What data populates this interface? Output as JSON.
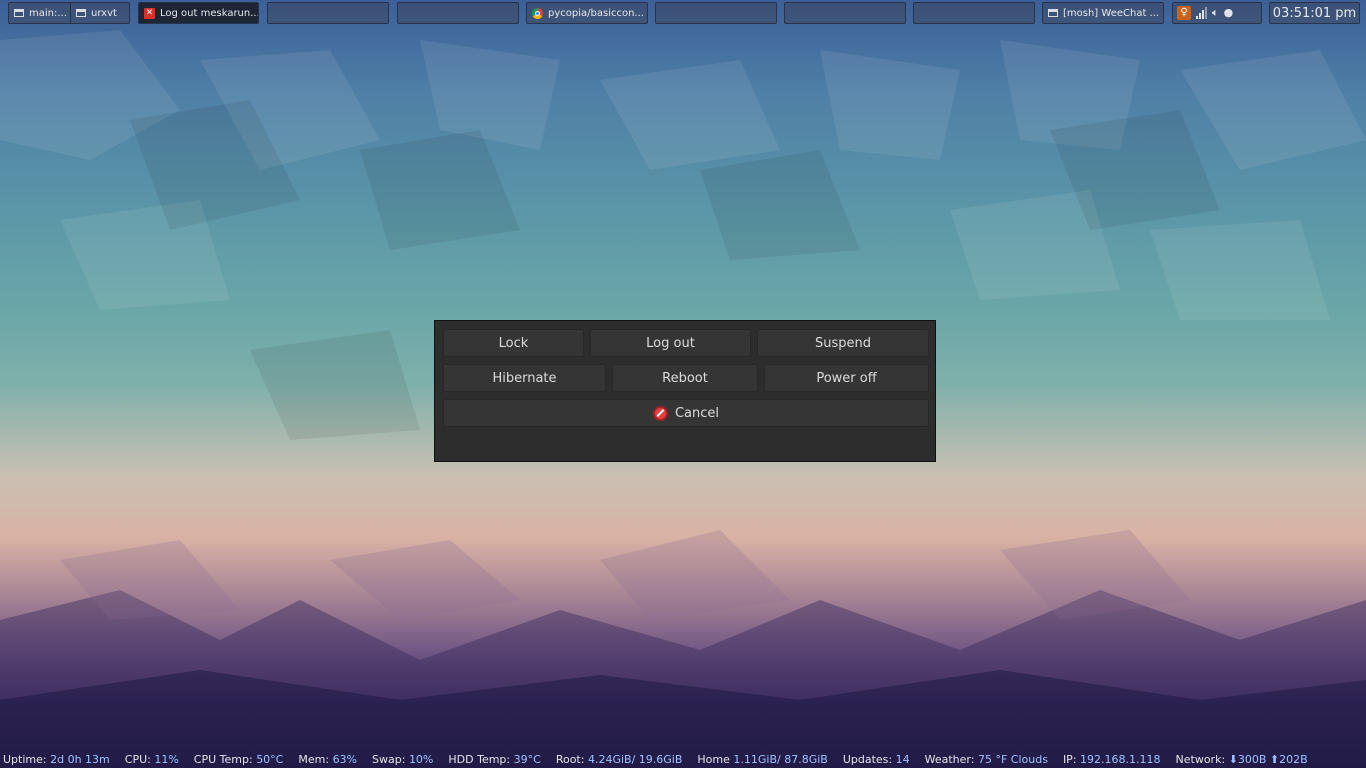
{
  "taskbar": {
    "tasks": [
      {
        "label": "main:...",
        "icon": "window-icon"
      },
      {
        "label": "urxvt",
        "icon": "window-icon"
      },
      {
        "label": "Log out meskarun...",
        "icon": "close-x-icon"
      },
      {
        "label": "pycopia/basiccon...",
        "icon": "chrome-icon"
      },
      {
        "label": "[mosh] WeeChat ...",
        "icon": "window-icon"
      }
    ],
    "tray_icons": [
      "ubuntu-one-icon",
      "network-signal-icon",
      "volume-icon",
      "user-icon"
    ],
    "clock": "03:51:01 pm"
  },
  "logout_dialog": {
    "buttons": {
      "lock": "Lock",
      "logout": "Log out",
      "suspend": "Suspend",
      "hibernate": "Hibernate",
      "reboot": "Reboot",
      "poweroff": "Power off",
      "cancel": "Cancel"
    },
    "cancel_icon": "cancel-icon"
  },
  "statusbar": {
    "items": [
      {
        "label": "Uptime:",
        "value": "2d 0h 13m"
      },
      {
        "label": "CPU:",
        "value": "11%"
      },
      {
        "label": "CPU Temp:",
        "value": "50°C"
      },
      {
        "label": "Mem:",
        "value": "63%"
      },
      {
        "label": "Swap:",
        "value": "10%"
      },
      {
        "label": "HDD Temp:",
        "value": "39°C"
      },
      {
        "label": "Root:",
        "value": "4.24GiB/ 19.6GiB"
      },
      {
        "label": "Home",
        "value": "1.11GiB/ 87.8GiB"
      },
      {
        "label": "Updates:",
        "value": "14"
      },
      {
        "label": "Weather:",
        "value": "75 °F  Clouds"
      },
      {
        "label": "IP:",
        "value": "192.168.1.118"
      },
      {
        "label": "Network:",
        "value": "⬇300B  ⬆202B"
      }
    ]
  },
  "colors": {
    "dialog_bg": "#2d2d2d",
    "button_bg": "#353535",
    "status_value": "#9fc4ff"
  }
}
